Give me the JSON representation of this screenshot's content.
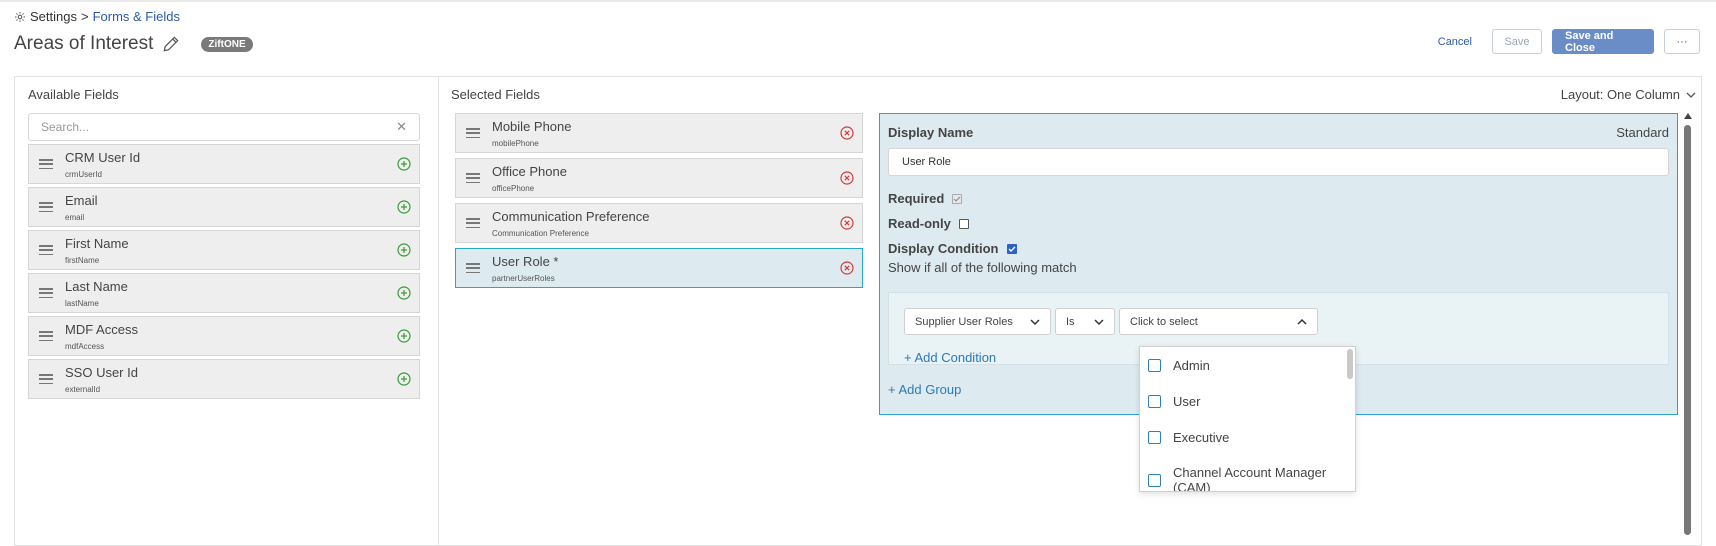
{
  "breadcrumb": {
    "root": "Settings",
    "separator": ">",
    "current": "Forms & Fields"
  },
  "header": {
    "title": "Areas of Interest",
    "badge": "ZiftONE"
  },
  "actions": {
    "cancel": "Cancel",
    "save": "Save",
    "save_close": "Save and Close",
    "more": "···"
  },
  "available": {
    "label": "Available Fields",
    "search_placeholder": "Search...",
    "items": [
      {
        "name": "CRM User Id",
        "key": "crmUserId"
      },
      {
        "name": "Email",
        "key": "email"
      },
      {
        "name": "First Name",
        "key": "firstName"
      },
      {
        "name": "Last Name",
        "key": "lastName"
      },
      {
        "name": "MDF Access",
        "key": "mdfAccess"
      },
      {
        "name": "SSO User Id",
        "key": "externalId"
      }
    ]
  },
  "selected": {
    "label": "Selected Fields",
    "layout": "Layout: One Column",
    "items": [
      {
        "name": "Mobile Phone",
        "key": "mobilePhone"
      },
      {
        "name": "Office Phone",
        "key": "officePhone"
      },
      {
        "name": "Communication Preference",
        "key": "Communication Preference"
      },
      {
        "name": "User Role *",
        "key": "partnerUserRoles"
      }
    ]
  },
  "properties": {
    "display_name_label": "Display Name",
    "type": "Standard",
    "display_name_value": "User Role",
    "required_label": "Required",
    "required": true,
    "readonly_label": "Read-only",
    "readonly": false,
    "display_condition_label": "Display Condition",
    "display_condition": true,
    "show_if": "Show if all of the following match",
    "condition_field": "Supplier User Roles",
    "condition_op": "Is",
    "condition_value_placeholder": "Click to select",
    "add_condition": "+ Add Condition",
    "add_group": "+ Add Group"
  },
  "dropdown": {
    "options": [
      "Admin",
      "User",
      "Executive",
      "Channel Account Manager (CAM)"
    ]
  },
  "colors": {
    "accent": "#2aa4c9",
    "primary_button": "#6b8dc7",
    "link": "#2a5aa8"
  }
}
